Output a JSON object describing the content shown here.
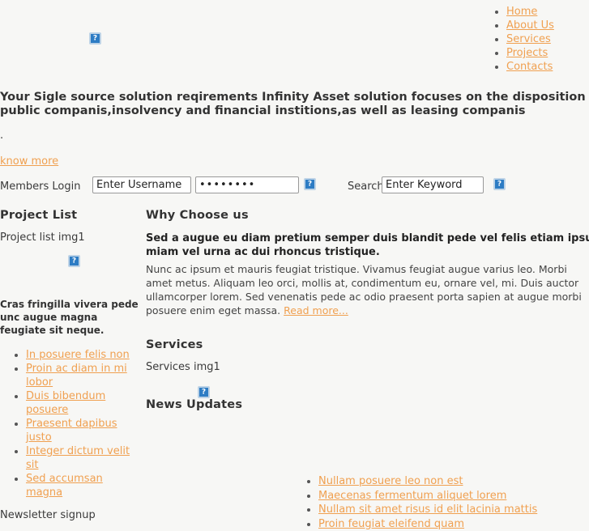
{
  "nav": {
    "items": [
      {
        "label": "Home"
      },
      {
        "label": "About Us"
      },
      {
        "label": "Services"
      },
      {
        "label": "Projects"
      },
      {
        "label": "Contacts"
      }
    ]
  },
  "logo": {
    "icon": "broken-image-icon"
  },
  "hero": {
    "line1": "Your Sigle source solution reqirements Infinity Asset solution focuses on the disposition of assets for private and",
    "line2": "public companis,insolvency and financial institions,as well as leasing companis",
    "dot": ".",
    "know_more": "know more"
  },
  "login": {
    "label": "Members Login",
    "username_value": "Enter Username",
    "username_placeholder": "Enter Username",
    "password_value": "••••••••",
    "submit_icon": "broken-image-icon"
  },
  "search": {
    "label": "Search",
    "value": "Enter Keyword",
    "placeholder": "Enter Keyword",
    "submit_icon": "broken-image-icon"
  },
  "project_list": {
    "heading": "Project List",
    "image_alt": "Project list img1",
    "image_icon": "broken-image-icon",
    "blurb": "Cras fringilla vivera pede unc augue magna feugiate sit neque.",
    "links": [
      {
        "label": "In posuere felis non"
      },
      {
        "label": "Proin ac diam in mi lobor"
      },
      {
        "label": "Duis bibendum posuere"
      },
      {
        "label": "Praesent dapibus justo"
      },
      {
        "label": "Integer dictum velit sit"
      },
      {
        "label": "Sed accumsan magna"
      }
    ],
    "newsletter": "Newsletter signup"
  },
  "why_choose": {
    "heading": "Why Choose us",
    "lead_line1": "Sed a augue eu diam pretium semper duis blandit pede vel felis etiam ipsum porbi dictum hendrerit",
    "lead_line2": "miam vel urna ac dui rhoncus tristique.",
    "body": "Nunc ac ipsum et mauris feugiat tristique. Vivamus feugiat augue varius leo. Morbi amet metus. Aliquam leo orci, mollis at, condimentum eu, ornare vel, mi. Duis auctor ullamcorper lorem. Sed venenatis pede ac odio praesent porta sapien at augue morbi posuere enim eget massa.",
    "read_more": "Read more..."
  },
  "services": {
    "heading": "Services",
    "image_alt": "Services img1",
    "image_icon": "broken-image-icon",
    "links": [
      {
        "label": "Nullam posuere leo non est"
      },
      {
        "label": "Maecenas fermentum aliquet lorem"
      },
      {
        "label": "Nullam sit amet risus id elit lacinia mattis"
      },
      {
        "label": "Proin feugiat eleifend quam"
      }
    ]
  },
  "news_updates": {
    "heading": "News Updates"
  },
  "colors": {
    "link": "#f0a050",
    "background": "#f7f7f5",
    "text": "#3a3a3a",
    "broken_img": "#2d7cc4"
  }
}
